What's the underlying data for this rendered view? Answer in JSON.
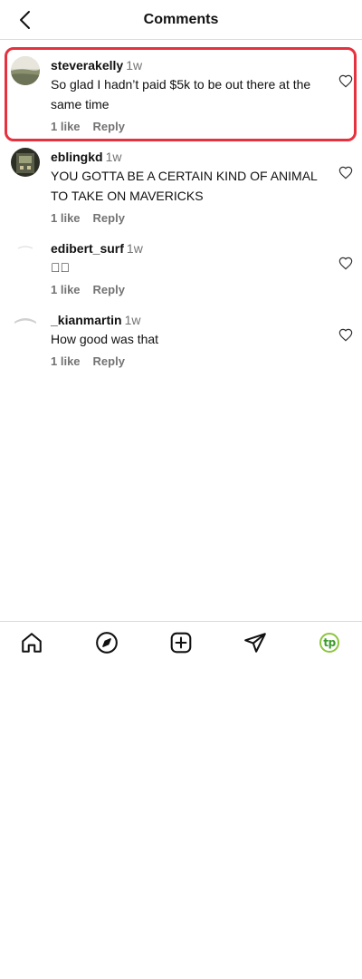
{
  "header": {
    "title": "Comments",
    "back_icon": "chevron-left-icon"
  },
  "comments": [
    {
      "username": "steverakelly",
      "time": "1w",
      "text": "So glad I hadn’t paid $5k to be out there at the same time",
      "likes": "1 like",
      "reply": "Reply",
      "highlighted": true
    },
    {
      "username": "eblingkd",
      "time": "1w",
      "text": "YOU GOTTA BE A CERTAIN KIND OF ANIMAL TO TAKE ON MAVERICKS",
      "likes": "1 like",
      "reply": "Reply",
      "highlighted": false
    },
    {
      "username": "edibert_surf",
      "time": "1w",
      "text": "󰀀󰀀",
      "likes": "1 like",
      "reply": "Reply",
      "highlighted": false
    },
    {
      "username": "_kianmartin",
      "time": "1w",
      "text": "How good was that",
      "likes": "1 like",
      "reply": "Reply",
      "highlighted": false
    }
  ],
  "tabbar": {
    "items": [
      "home-icon",
      "explore-compass-icon",
      "create-plus-icon",
      "direct-send-icon",
      "profile-avatar-icon"
    ],
    "profile_initials": "tp"
  },
  "colors": {
    "highlight": "#e5323e",
    "muted": "#737373",
    "divider": "#dbdbdb",
    "profile_ring": "#8cc63f"
  }
}
